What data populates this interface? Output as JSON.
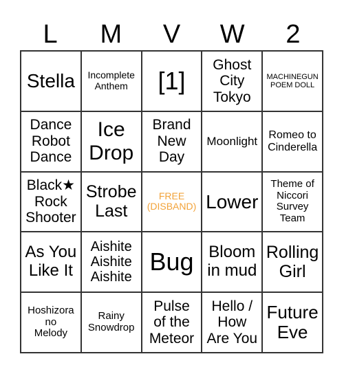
{
  "header": [
    "L",
    "M",
    "V",
    "W",
    "2"
  ],
  "cells": [
    "Stella",
    "Incomplete\nAnthem",
    "[1]",
    "Ghost\nCity\nTokyo",
    "MACHINEGUN\nPOEM DOLL",
    "Dance\nRobot\nDance",
    "Ice\nDrop",
    "Brand\nNew\nDay",
    "Moonlight",
    "Romeo to\nCinderella",
    "Black★\nRock\nShooter",
    "Strobe\nLast",
    "FREE\n(DISBAND)",
    "Lower",
    "Theme of\nNiccori\nSurvey\nTeam",
    "As You\nLike It",
    "Aishite\nAishite\nAishite",
    "Bug",
    "Bloom\nin mud",
    "Rolling\nGirl",
    "Hoshizora\nno\nMelody",
    "Rainy\nSnowdrop",
    "Pulse\nof the\nMeteor",
    "Hello /\nHow\nAre You",
    "Future\nEve"
  ],
  "colors": {
    "free_text": "#f2a33a",
    "grid": "#333333"
  }
}
